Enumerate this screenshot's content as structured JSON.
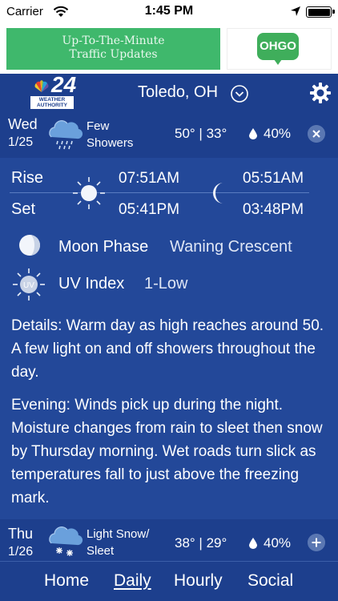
{
  "status": {
    "carrier": "Carrier",
    "time": "1:45 PM"
  },
  "ad": {
    "traffic_line1": "Up-To-The-Minute",
    "traffic_line2": "Traffic Updates",
    "brand": "OHGO"
  },
  "header": {
    "logo_number": "24",
    "logo_text_line1": "WEATHER",
    "logo_text_line2": "AUTHORITY",
    "city": "Toledo, OH"
  },
  "day1": {
    "day": "Wed",
    "date": "1/25",
    "cond_line1": "Few",
    "cond_line2": "Showers",
    "temps": "50° | 33°",
    "precip": "40%",
    "icon": "rain-cloud-icon"
  },
  "detail": {
    "rise_label": "Rise",
    "set_label": "Set",
    "sunrise": "07:51AM",
    "sunset": "05:41PM",
    "moonrise": "05:51AM",
    "moonset": "03:48PM",
    "moon_phase_label": "Moon Phase",
    "moon_phase": "Waning Crescent",
    "uv_label": "UV Index",
    "uv_value": "1-Low",
    "uv_icon_text": "UV",
    "details_text": "Details: Warm day as high reaches around 50.  A few light on and off showers throughout the day.",
    "evening_text": "Evening: Winds pick up during the night. Moisture changes from rain to sleet then snow by Thursday morning.  Wet roads turn slick as temperatures fall to just above the freezing mark."
  },
  "day2": {
    "day": "Thu",
    "date": "1/26",
    "cond_line1": "Light Snow/",
    "cond_line2": "Sleet",
    "temps": "38° | 29°",
    "precip": "40%",
    "icon": "snow-cloud-icon"
  },
  "tabs": {
    "home": "Home",
    "daily": "Daily",
    "hourly": "Hourly",
    "social": "Social",
    "active": "daily"
  },
  "colors": {
    "background": "#1d3f8d",
    "panel": "#234899",
    "ad_green": "#3fb86c",
    "button": "#5a77b2"
  }
}
